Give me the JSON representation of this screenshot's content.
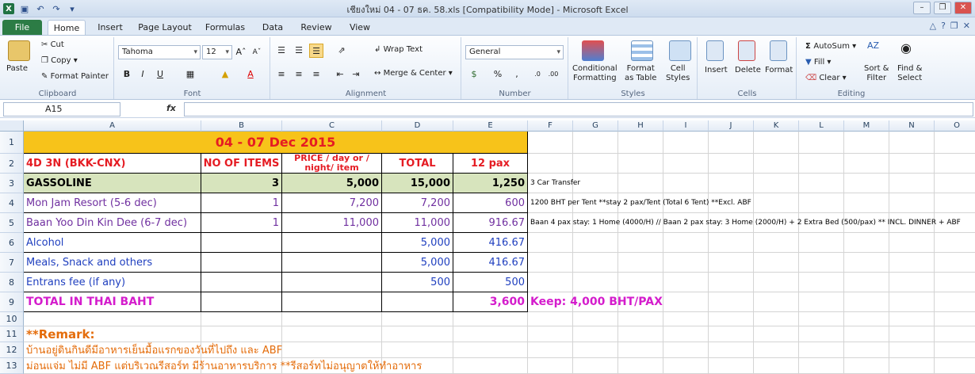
{
  "window": {
    "title": "เชียงใหม่ 04 - 07 ธค. 58.xls  [Compatibility Mode]  -  Microsoft Excel"
  },
  "ribbon": {
    "tabs": [
      "File",
      "Home",
      "Insert",
      "Page Layout",
      "Formulas",
      "Data",
      "Review",
      "View"
    ],
    "active_tab": "Home",
    "clipboard": {
      "paste": "Paste",
      "cut": "Cut",
      "copy": "Copy",
      "format_painter": "Format Painter",
      "label": "Clipboard"
    },
    "font": {
      "name": "Tahoma",
      "size": "12",
      "label": "Font"
    },
    "alignment": {
      "wrap": "Wrap Text",
      "merge": "Merge & Center",
      "label": "Alignment"
    },
    "number": {
      "format": "General",
      "label": "Number"
    },
    "styles": {
      "conditional": [
        "Conditional",
        "Formatting"
      ],
      "format_table": [
        "Format",
        "as Table"
      ],
      "cell_styles": [
        "Cell",
        "Styles"
      ],
      "label": "Styles"
    },
    "cells": {
      "insert": "Insert",
      "delete": "Delete",
      "format": "Format",
      "label": "Cells"
    },
    "editing": {
      "autosum": "AutoSum",
      "fill": "Fill",
      "clear": "Clear",
      "sort": [
        "Sort &",
        "Filter"
      ],
      "find": [
        "Find &",
        "Select"
      ],
      "label": "Editing"
    }
  },
  "formula_bar": {
    "name_box": "A15",
    "fx": "fx",
    "value": ""
  },
  "sheet": {
    "columns": [
      "A",
      "B",
      "C",
      "D",
      "E",
      "F",
      "G",
      "H",
      "I",
      "J",
      "K",
      "L",
      "M",
      "N",
      "O"
    ],
    "rows": [
      "1",
      "2",
      "3",
      "4",
      "5",
      "6",
      "7",
      "8",
      "9",
      "10",
      "11",
      "12",
      "13"
    ],
    "title": "04 - 07 Dec 2015",
    "headers": {
      "a": "4D 3N (BKK-CNX)",
      "b": "NO OF ITEMS",
      "c1": "PRICE / day or /",
      "c2": "night/ item",
      "d": "TOTAL",
      "e": "12 pax"
    },
    "data_rows": [
      {
        "a": "GASSOLINE",
        "b": "3",
        "c": "5,000",
        "d": "15,000",
        "e": "1,250",
        "f": "3 Car Transfer"
      },
      {
        "a": "Mon Jam Resort (5-6 dec)",
        "b": "1",
        "c": "7,200",
        "d": "7,200",
        "e": "600",
        "f": "1200 BHT per Tent **stay 2 pax/Tent (Total 6 Tent) **Excl. ABF"
      },
      {
        "a": "Baan Yoo Din Kin Dee (6-7 dec)",
        "b": "1",
        "c": "11,000",
        "d": "11,000",
        "e": "916.67",
        "f": "Baan 4 pax stay: 1 Home (4000/H) // Baan 2 pax stay: 3 Home (2000/H) + 2 Extra Bed (500/pax) ** INCL. DINNER + ABF"
      },
      {
        "a": "Alcohol",
        "b": "",
        "c": "",
        "d": "5,000",
        "e": "416.67",
        "f": ""
      },
      {
        "a": "Meals, Snack and others",
        "b": "",
        "c": "",
        "d": "5,000",
        "e": "416.67",
        "f": ""
      },
      {
        "a": "Entrans fee (if any)",
        "b": "",
        "c": "",
        "d": "500",
        "e": "500",
        "f": ""
      }
    ],
    "total": {
      "label": "TOTAL IN THAI BAHT",
      "value": "3,600",
      "keep": "Keep: 4,000 BHT/PAX"
    },
    "remark_title": "**Remark:",
    "remark_1": "บ้านอยู่ดินกินดีมีอาหารเย็นมื้อแรกของวันที่ไปถึง และ ABF",
    "remark_2": "ม่อนแจ่ม ไม่มี ABF แต่บริเวณรีสอร์ท มีร้านอาหารบริการ **รีสอร์ทไม่อนุญาตให้ทำอาหาร"
  },
  "colors": {
    "title_fill": "#f7c31a",
    "title_text": "#e51c23",
    "header_text": "#e51c23",
    "gas_fill": "#d7e4bd",
    "purple_text": "#7030a0",
    "blue_text": "#1f3fbf",
    "magenta_text": "#d41ccc",
    "orange_text": "#e46c0a"
  }
}
